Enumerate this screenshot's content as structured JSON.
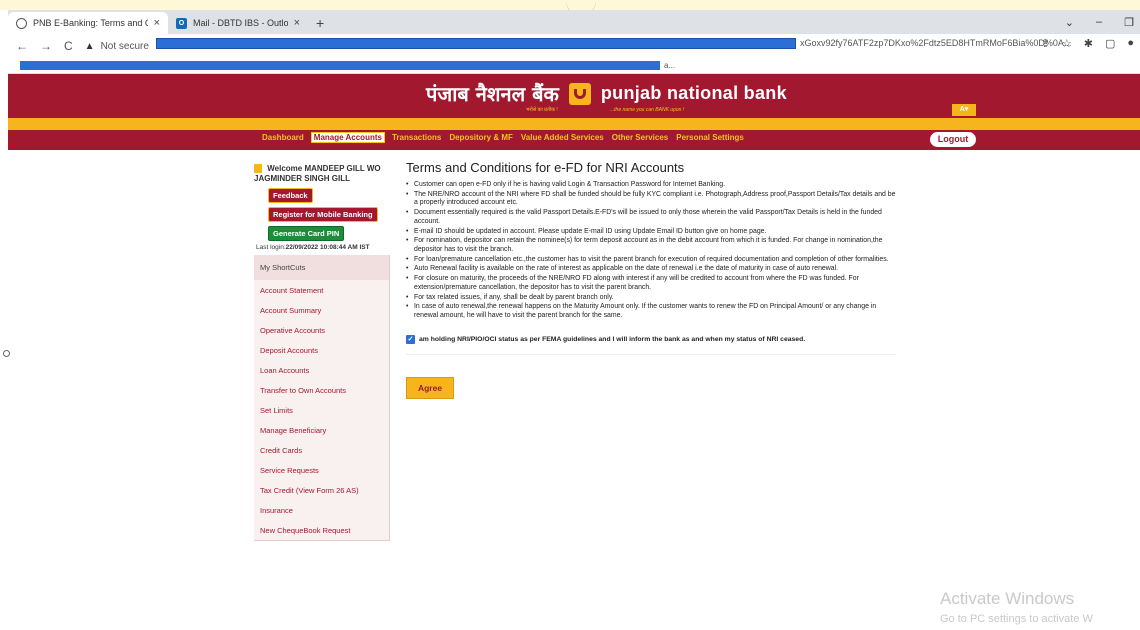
{
  "browser": {
    "tabs": [
      {
        "title": "PNB E-Banking: Terms and Condi",
        "active": true
      },
      {
        "title": "Mail - DBTD IBS - Outlook",
        "active": false
      }
    ],
    "new_tab": "+",
    "address": {
      "security": "Not secure",
      "url_visible_tail": "xGoxv92fy76ATF2zp7DKxo%2Fdtz5ED8HTmRMoF6Bia%0D%0A..."
    },
    "bookmark_tail": "a..."
  },
  "header": {
    "brand_hindi": "पंजाब नैशनल बैंक",
    "brand_hindi_tagline": "भरोसे का प्रतीक !",
    "brand_english": "punjab national bank",
    "brand_english_tagline": "...the name you can BANK upon !",
    "language_button": "A"
  },
  "menu": {
    "items": [
      {
        "label": "Dashboard",
        "active": false
      },
      {
        "label": "Manage Accounts",
        "active": true
      },
      {
        "label": "Transactions",
        "active": false
      },
      {
        "label": "Depository & MF",
        "active": false
      },
      {
        "label": "Value Added Services",
        "active": false
      },
      {
        "label": "Other Services",
        "active": false
      },
      {
        "label": "Personal Settings",
        "active": false
      }
    ],
    "logout": "Logout"
  },
  "sidebar": {
    "welcome_label": "Welcome",
    "welcome_name": "MANDEEP GILL WO JAGMINDER SINGH GILL",
    "feedback": "Feedback",
    "register_mobile": "Register for Mobile Banking",
    "generate_pin": "Generate Card PIN",
    "last_login_label": "Last login:",
    "last_login_value": "22/09/2022 10:08:44 AM IST",
    "shortcuts_title": "My ShortCuts",
    "shortcuts": [
      "Account Statement",
      "Account Summary",
      "Operative Accounts",
      "Deposit Accounts",
      "Loan Accounts",
      "Transfer to Own Accounts",
      "Set Limits",
      "Manage Beneficiary",
      "Credit Cards",
      "Service Requests",
      "Tax Credit (View Form 26 AS)",
      "Insurance",
      "New ChequeBook Request"
    ]
  },
  "main": {
    "title": "Terms and Conditions for e-FD for NRI Accounts",
    "terms": [
      "Customer can open e-FD only if he is having valid Login & Transaction Password for Internet Banking.",
      "The NRE/NRO account of the NRI where FD shall be funded should be fully KYC compliant i.e. Photograph,Address proof,Passport Details/Tax details and be a properly introduced account etc.",
      "Document essentially required is the valid Passport Details.E-FD's will be issued to only those wherein the valid Passport/Tax Details is held in the funded account.",
      "E-mail ID should be updated in account. Please update E-mail ID using Update Email ID button give on home page.",
      "For nomination, depositor can retain the nominee(s) for term deposit account as in the debit account from which it is funded. For change in nomination,the depositor has to visit the branch.",
      "For loan/premature cancellation etc.,the customer has to visit the parent branch for execution of required documentation and completion of other formalities.",
      "Auto Renewal facility is available on the rate of interest as applicable on the date of renewal i.e the date of maturity in case of auto renewal.",
      "For closure on maturity, the proceeds of the NRE/NRO FD along with interest if any will be credited to account from where the FD was funded. For extension/premature cancellation, the depositor has to visit the parent branch.",
      "For tax related issues, if any, shall be dealt by parent branch only.",
      "In case of auto renewal,the renewal happens on the Maturity Amount only. If the customer wants to renew the FD on Principal Amount/ or any change in renewal amount, he will have to visit the parent branch for the same."
    ],
    "consent": "am holding NRI/PIO/OCI status as per FEMA guidelines and I will inform the bank as and when my status of NRI ceased.",
    "consent_checked": true,
    "agree": "Agree"
  },
  "watermark": {
    "line1": "Activate Windows",
    "line2": "Go to PC settings to activate W"
  },
  "colors": {
    "brand_maroon": "#a2192f",
    "brand_gold": "#f6b51c",
    "link": "#a2192f"
  }
}
